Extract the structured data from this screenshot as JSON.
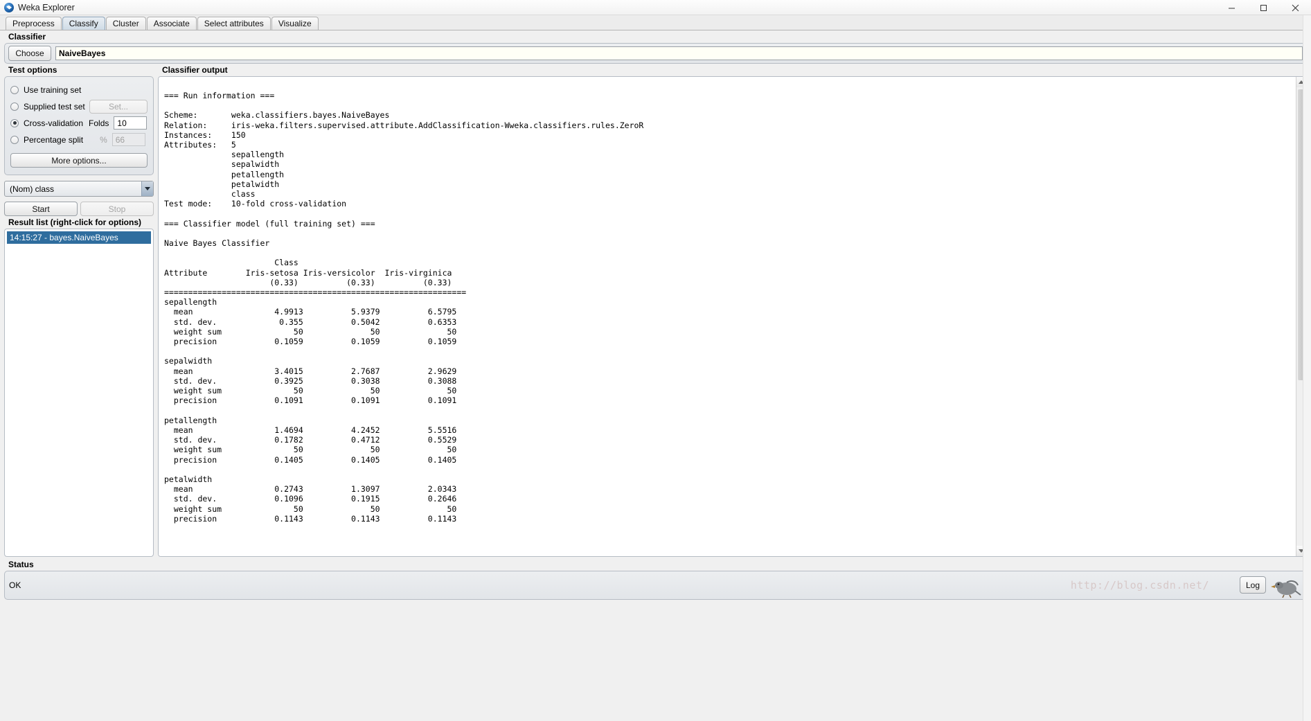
{
  "window": {
    "title": "Weka Explorer",
    "icon": "weka-bird-icon",
    "minimize_label": "─",
    "maximize_label": "❐",
    "close_label": "✕"
  },
  "tabs": [
    {
      "label": "Preprocess",
      "active": false
    },
    {
      "label": "Classify",
      "active": true
    },
    {
      "label": "Cluster",
      "active": false
    },
    {
      "label": "Associate",
      "active": false
    },
    {
      "label": "Select attributes",
      "active": false
    },
    {
      "label": "Visualize",
      "active": false
    }
  ],
  "classifier": {
    "section_title": "Classifier",
    "choose_label": "Choose",
    "value": "NaiveBayes"
  },
  "test_options": {
    "section_title": "Test options",
    "options": [
      {
        "label": "Use training set",
        "selected": false
      },
      {
        "label": "Supplied test set",
        "selected": false,
        "button_label": "Set...",
        "button_enabled": false
      },
      {
        "label": "Cross-validation",
        "selected": true,
        "field_label": "Folds",
        "field_value": "10",
        "field_enabled": true
      },
      {
        "label": "Percentage split",
        "selected": false,
        "field_label": "%",
        "field_value": "66",
        "field_enabled": false
      }
    ],
    "more_options_label": "More options..."
  },
  "class_selector": {
    "value": "(Nom) class",
    "arrow_icon": "chevron-down-icon"
  },
  "actions": {
    "start_label": "Start",
    "stop_label": "Stop",
    "stop_enabled": false
  },
  "result_list": {
    "section_title": "Result list (right-click for options)",
    "items": [
      {
        "label": "14:15:27 - bayes.NaiveBayes",
        "selected": true
      }
    ]
  },
  "classifier_output": {
    "section_title": "Classifier output",
    "text": "=== Run information ===\n\nScheme:       weka.classifiers.bayes.NaiveBayes\nRelation:     iris-weka.filters.supervised.attribute.AddClassification-Wweka.classifiers.rules.ZeroR\nInstances:    150\nAttributes:   5\n              sepallength\n              sepalwidth\n              petallength\n              petalwidth\n              class\nTest mode:    10-fold cross-validation\n\n=== Classifier model (full training set) ===\n\nNaive Bayes Classifier\n\n                       Class\nAttribute        Iris-setosa Iris-versicolor  Iris-virginica\n                      (0.33)          (0.33)          (0.33)\n===============================================================\nsepallength\n  mean                 4.9913          5.9379          6.5795\n  std. dev.             0.355          0.5042          0.6353\n  weight sum               50              50              50\n  precision            0.1059          0.1059          0.1059\n\nsepalwidth\n  mean                 3.4015          2.7687          2.9629\n  std. dev.            0.3925          0.3038          0.3088\n  weight sum               50              50              50\n  precision            0.1091          0.1091          0.1091\n\npetallength\n  mean                 1.4694          4.2452          5.5516\n  std. dev.            0.1782          0.4712          0.5529\n  weight sum               50              50              50\n  precision            0.1405          0.1405          0.1405\n\npetalwidth\n  mean                 0.2743          1.3097          2.0343\n  std. dev.            0.1096          0.1915          0.2646\n  weight sum               50              50              50\n  precision            0.1143          0.1143          0.1143\n",
    "scrollbar": {
      "up_icon": "scroll-up-icon",
      "down_icon": "scroll-down-icon"
    }
  },
  "status": {
    "section_title": "Status",
    "message": "OK",
    "log_label": "Log",
    "watermark": "http://blog.csdn.net/",
    "bird_icon": "weka-bird-animation"
  },
  "colors": {
    "accent": "#2f6d9e",
    "tab_active": "#cfdbe6",
    "panel_bg": "#e6e8eb",
    "field_bg": "#fffff6"
  }
}
